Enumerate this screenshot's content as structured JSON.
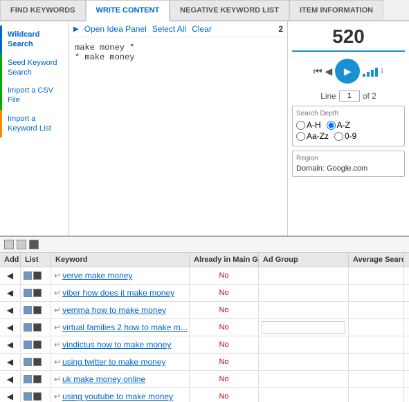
{
  "tabs": [
    {
      "id": "find-keywords",
      "label": "FIND KEYWORDS",
      "active": false
    },
    {
      "id": "write-content",
      "label": "WRITE CONTENT",
      "active": true
    },
    {
      "id": "negative-keyword",
      "label": "NEGATIVE KEYWORD LIST",
      "active": false
    },
    {
      "id": "item-information",
      "label": "ITEM INFORMATION",
      "active": false
    }
  ],
  "sidebar": {
    "items": [
      {
        "id": "wildcard-search",
        "label": "Wildcard Search",
        "state": "active-blue"
      },
      {
        "id": "seed-keyword",
        "label": "Seed Keyword Search",
        "state": "active-green"
      },
      {
        "id": "import-csv",
        "label": "Import a CSV File",
        "state": "active-green"
      },
      {
        "id": "import-keyword",
        "label": "Import a Keyword List",
        "state": "active-orange"
      }
    ]
  },
  "center": {
    "open_idea_panel": "Open Idea Panel",
    "select_all": "Select All",
    "clear": "Clear",
    "count": "2",
    "textarea_content": "make money *\n* make money"
  },
  "right": {
    "count": "520",
    "line_label": "Line",
    "line_value": "1",
    "line_of": "of 2",
    "search_depth": {
      "title": "Search Depth",
      "options": [
        {
          "id": "ah",
          "label": "A-H",
          "checked": false
        },
        {
          "id": "az",
          "label": "A-Z",
          "checked": true
        },
        {
          "id": "aazz",
          "label": "Aa-Zz",
          "checked": false
        },
        {
          "id": "09",
          "label": "0-9",
          "checked": false
        }
      ]
    },
    "region": {
      "title": "Region",
      "domain": "Domain: Google.com"
    }
  },
  "grid": {
    "headers": [
      {
        "id": "add",
        "label": "Add"
      },
      {
        "id": "list",
        "label": "List"
      },
      {
        "id": "keyword",
        "label": "Keyword"
      },
      {
        "id": "already",
        "label": "Already in Main Grid?"
      },
      {
        "id": "adgroup",
        "label": "Ad Group"
      },
      {
        "id": "avg",
        "label": "Average Searche"
      }
    ],
    "rows": [
      {
        "keyword": "verve make money",
        "already": "No",
        "adgroup": "",
        "show_adgroup": false
      },
      {
        "keyword": "viber how does it make money",
        "already": "No",
        "adgroup": "",
        "show_adgroup": false
      },
      {
        "keyword": "vemma how to make money",
        "already": "No",
        "adgroup": "",
        "show_adgroup": false
      },
      {
        "keyword": "virtual families 2 how to make m...",
        "already": "No",
        "adgroup": "",
        "show_adgroup": true
      },
      {
        "keyword": "vindictus how to make money",
        "already": "No",
        "adgroup": "",
        "show_adgroup": false
      },
      {
        "keyword": "using twitter to make money",
        "already": "No",
        "adgroup": "",
        "show_adgroup": false
      },
      {
        "keyword": "uk make money online",
        "already": "No",
        "adgroup": "",
        "show_adgroup": false
      },
      {
        "keyword": "using youtube to make money",
        "already": "No",
        "adgroup": "",
        "show_adgroup": false
      }
    ]
  }
}
